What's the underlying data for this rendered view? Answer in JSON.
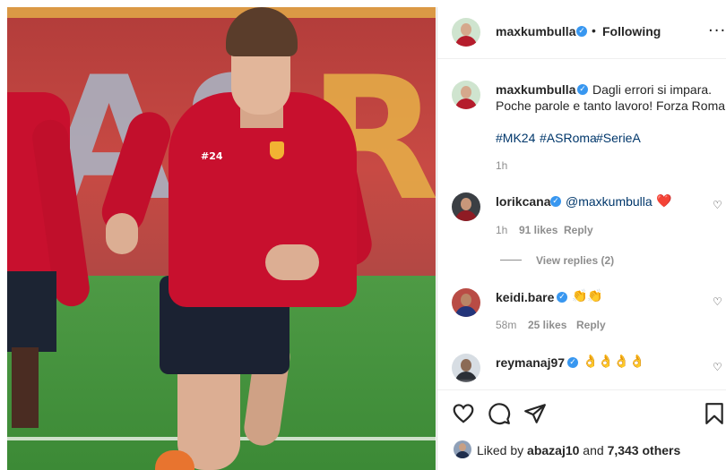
{
  "post": {
    "username": "maxkumbulla",
    "follow_separator": "•",
    "follow_status": "Following",
    "more_label": "···"
  },
  "caption": {
    "username": "maxkumbulla",
    "line1": "Dagli errori si impara.",
    "line2": "Poche parole e tanto lavoro! Forza Roma.",
    "hashtags": [
      "#MK24",
      "#ASRoma",
      "#SerieA"
    ],
    "time": "1h"
  },
  "comments": [
    {
      "username": "lorikcana",
      "mention": "@maxkumbulla",
      "emoji": "❤️",
      "time": "1h",
      "likes": "91 likes",
      "reply": "Reply",
      "view_replies": "View replies (2)"
    },
    {
      "username": "keidi.bare",
      "emoji": "👏👏",
      "time": "58m",
      "likes": "25 likes",
      "reply": "Reply"
    },
    {
      "username": "reymanaj97",
      "emoji": "👌👌👌👌"
    }
  ],
  "liked_by": {
    "prefix": "Liked by ",
    "user": "abazaj10",
    "middle": " and ",
    "others": "7,343 others"
  },
  "icons": [
    "verified-badge-icon",
    "heart-icon",
    "comment-icon",
    "share-icon",
    "bookmark-icon",
    "more-options-icon"
  ],
  "colors": {
    "accent": "#3897f0",
    "link": "#00376b",
    "heart": "#ed4956",
    "muted": "#8e8e8e"
  }
}
